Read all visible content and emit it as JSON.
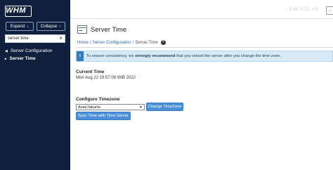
{
  "sidebar": {
    "logo": "WHM",
    "expand_label": "Expand",
    "collapse_label": "Collapse",
    "search_value": "server time",
    "nav_category": "Server Configuration",
    "nav_item": "Server Time"
  },
  "topbar": {
    "load_values": [
      "5.49",
      "5.71",
      "4.9"
    ]
  },
  "main": {
    "title": "Server Time",
    "breadcrumb": {
      "home": "Home",
      "section": "Server Configuration",
      "current": "Server Time",
      "separator": "/"
    },
    "alert": {
      "icon": "i",
      "text_before": "To ensure consistency, we ",
      "text_bold": "strongly recommend",
      "text_after": " that you reboot the server after you change the time zone."
    },
    "current_time_label": "Current Time",
    "current_time_value": "Mon Aug 22 19:57:08 WIB 2022",
    "configure_tz_label": "Configure Timezone",
    "timezone_selected": "Asia/Jakarta",
    "change_tz_button": "Change TimeZone",
    "sync_button": "Sync Time with Time Server"
  },
  "colors": {
    "sidebar_bg": "#0f1f3d",
    "accent_blue": "#4a90d9",
    "alert_bg": "#d9eaf7"
  }
}
